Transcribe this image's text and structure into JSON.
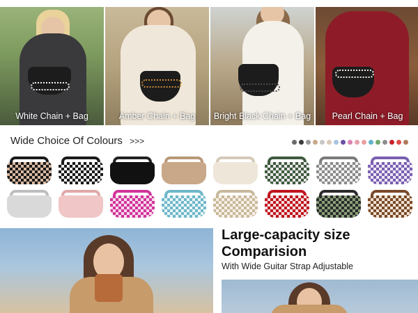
{
  "hero": {
    "tiles": [
      {
        "caption": "White Chain + Bag"
      },
      {
        "caption": "Amber Chain + Bag"
      },
      {
        "caption": "Bright Black Chain + Bag"
      },
      {
        "caption": "Pearl Chain + Bag"
      }
    ]
  },
  "colours": {
    "title": "Wide Choice Of Colours",
    "arrow": ">>>",
    "swatch_colors": [
      "#6b6b6b",
      "#3a3a3a",
      "#9a9a9a",
      "#c9a98a",
      "#c7c7c7",
      "#d9c8b8",
      "#a8c4e0",
      "#6a4fa3",
      "#d883b0",
      "#e6a1b0",
      "#e8a0a0",
      "#5fb4c9",
      "#6fa86b",
      "#8e8e8e",
      "#c8212a",
      "#e04a4a",
      "#b07a5a"
    ],
    "bags_row1": [
      {
        "style": "check",
        "a": "#1a1a1a",
        "b": "#d9b8a0",
        "strap": "#1a1a1a"
      },
      {
        "style": "check",
        "a": "#1a1a1a",
        "b": "#f2f2f2",
        "strap": "#1a1a1a"
      },
      {
        "style": "solid",
        "a": "#111111",
        "b": "#111111",
        "strap": "#222222"
      },
      {
        "style": "solid",
        "a": "#c8a888",
        "b": "#c8a888",
        "strap": "#b89878"
      },
      {
        "style": "solid",
        "a": "#efe6da",
        "b": "#efe6da",
        "strap": "#d6c9b8"
      },
      {
        "style": "check",
        "a": "#3f5a3f",
        "b": "#e8e8e8",
        "strap": "#3f5a3f"
      },
      {
        "style": "check",
        "a": "#8a8a8a",
        "b": "#f2f2f2",
        "strap": "#7a7a7a"
      },
      {
        "style": "check",
        "a": "#7a5fb0",
        "b": "#ece6f5",
        "strap": "#7a5fb0"
      }
    ],
    "bags_row2": [
      {
        "style": "solid",
        "a": "#d9d9d9",
        "b": "#d9d9d9",
        "strap": "#bdbdbd"
      },
      {
        "style": "solid",
        "a": "#f0c6c6",
        "b": "#f0c6c6",
        "strap": "#e0a8a8"
      },
      {
        "style": "check",
        "a": "#d2339a",
        "b": "#f7d9ec",
        "strap": "#d2339a"
      },
      {
        "style": "check",
        "a": "#6fb7c9",
        "b": "#e9f6f9",
        "strap": "#6fb7c9"
      },
      {
        "style": "check",
        "a": "#c8b89a",
        "b": "#f7f1e8",
        "strap": "#c8b89a"
      },
      {
        "style": "check",
        "a": "#c0141e",
        "b": "#f5dede",
        "strap": "#c0141e"
      },
      {
        "style": "check",
        "a": "#2a2a2a",
        "b": "#8aa07a",
        "strap": "#2a2a2a"
      },
      {
        "style": "check",
        "a": "#7a4a2a",
        "b": "#efe2d3",
        "strap": "#7a4a2a"
      }
    ]
  },
  "capacity": {
    "title_line1": "Large-capacity size",
    "title_line2": "Comparision",
    "subtitle": "With Wide Guitar Strap Adjustable"
  }
}
